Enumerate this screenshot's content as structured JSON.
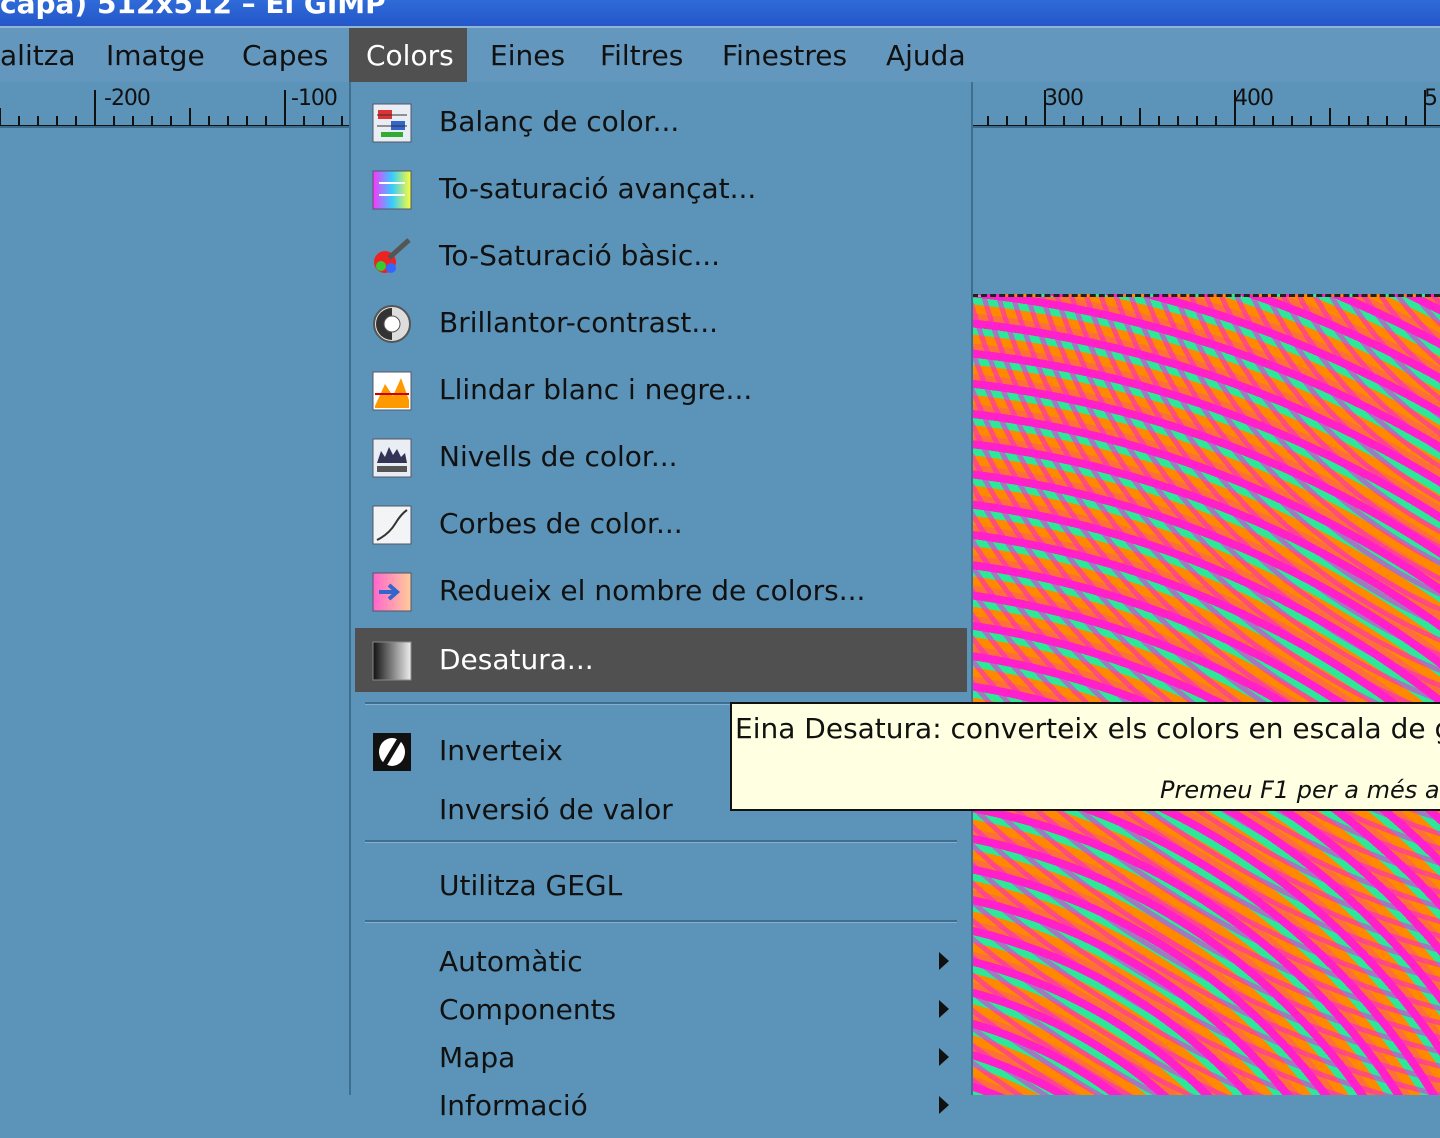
{
  "window": {
    "title_fragment": "capa) 512x512 – El GIMP"
  },
  "menubar": {
    "items": [
      {
        "label": "alitza",
        "mnemonic": ""
      },
      {
        "label": "Imatge",
        "mnemonic": "I"
      },
      {
        "label": "Capes",
        "mnemonic": "C"
      },
      {
        "label": "Colors",
        "mnemonic": "C"
      },
      {
        "label": "Eines",
        "mnemonic": "E"
      },
      {
        "label": "Filtres",
        "mnemonic": "r"
      },
      {
        "label": "Finestres",
        "mnemonic": "F"
      },
      {
        "label": "Ajuda",
        "mnemonic": "j"
      }
    ]
  },
  "ruler": {
    "labels": [
      "-200",
      "-100",
      "300",
      "400",
      "5"
    ]
  },
  "colors_menu": {
    "items": [
      {
        "label": "Balanç de color...",
        "icon": "color-balance-icon"
      },
      {
        "label": "To-saturació avançat...",
        "icon": "hue-saturation-icon"
      },
      {
        "label": "To-Saturació bàsic...",
        "icon": "colorize-icon"
      },
      {
        "label": "Brillantor-contrast...",
        "icon": "brightness-contrast-icon"
      },
      {
        "label": "Llindar blanc i negre...",
        "icon": "threshold-icon"
      },
      {
        "label": "Nivells de color...",
        "icon": "levels-icon"
      },
      {
        "label": "Corbes de color...",
        "icon": "curves-icon"
      },
      {
        "label": "Redueix el nombre de colors...",
        "icon": "posterize-icon"
      },
      {
        "label": "Desatura...",
        "icon": "desaturate-icon"
      }
    ],
    "invert_items": [
      {
        "label": "Inverteix",
        "icon": "invert-icon"
      },
      {
        "label": "Inversió de valor",
        "icon": ""
      }
    ],
    "gegl": {
      "label": "Utilitza GEGL"
    },
    "submenus": [
      {
        "label": "Automàtic"
      },
      {
        "label": "Components"
      },
      {
        "label": "Mapa"
      },
      {
        "label": "Informació"
      }
    ],
    "highlighted": "Desatura..."
  },
  "tooltip": {
    "text": "Eina Desatura: converteix els colors en escala de gri",
    "help": "Premeu F1 per a més a"
  },
  "colors": {
    "background": "#5b94b8",
    "menubar": "#6497bd",
    "highlight": "#505050",
    "tooltip": "#ffffe1"
  }
}
